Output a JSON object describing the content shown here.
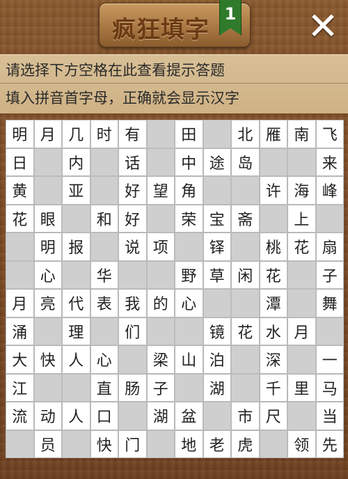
{
  "header": {
    "title": "疯狂填字",
    "level": "1",
    "close_label": "✕"
  },
  "hint": {
    "line1": "请选择下方空格在此查看提示答题",
    "line2": "填入拼音首字母，正确就会显示汉字"
  },
  "grid": {
    "rows": [
      [
        "明",
        "月",
        "几",
        "时",
        "有",
        "",
        "田",
        "",
        "北",
        "雁",
        "南",
        "飞"
      ],
      [
        "日",
        "",
        "内",
        "",
        "话",
        "",
        "中",
        "途",
        "岛",
        "",
        "",
        "来"
      ],
      [
        "黄",
        "",
        "亚",
        "",
        "好",
        "望",
        "角",
        "",
        "",
        "许",
        "海",
        "峰"
      ],
      [
        "花",
        "眼",
        "",
        "和",
        "好",
        "",
        "荣",
        "宝",
        "斋",
        "",
        "上",
        ""
      ],
      [
        "",
        "明",
        "报",
        "",
        "说",
        "项",
        "",
        "铎",
        "",
        "桃",
        "花",
        "扇"
      ],
      [
        "",
        "心",
        "",
        "华",
        "",
        "",
        "野",
        "草",
        "闲",
        "花",
        "",
        "子"
      ],
      [
        "月",
        "亮",
        "代",
        "表",
        "我",
        "的",
        "心",
        "",
        "",
        "潭",
        "",
        "舞"
      ],
      [
        "涌",
        "",
        "理",
        "",
        "们",
        "",
        "",
        "镜",
        "花",
        "水",
        "月",
        ""
      ],
      [
        "大",
        "快",
        "人",
        "心",
        "",
        "梁",
        "山",
        "泊",
        "",
        "深",
        "",
        "一"
      ],
      [
        "江",
        "",
        "",
        "直",
        "肠",
        "子",
        "",
        "湖",
        "",
        "千",
        "里",
        "马"
      ],
      [
        "流",
        "动",
        "人",
        "口",
        "",
        "湖",
        "盆",
        "",
        "市",
        "尺",
        "",
        "当"
      ],
      [
        "",
        "员",
        "",
        "快",
        "门",
        "",
        "地",
        "老",
        "虎",
        "",
        "领",
        "先"
      ]
    ]
  }
}
